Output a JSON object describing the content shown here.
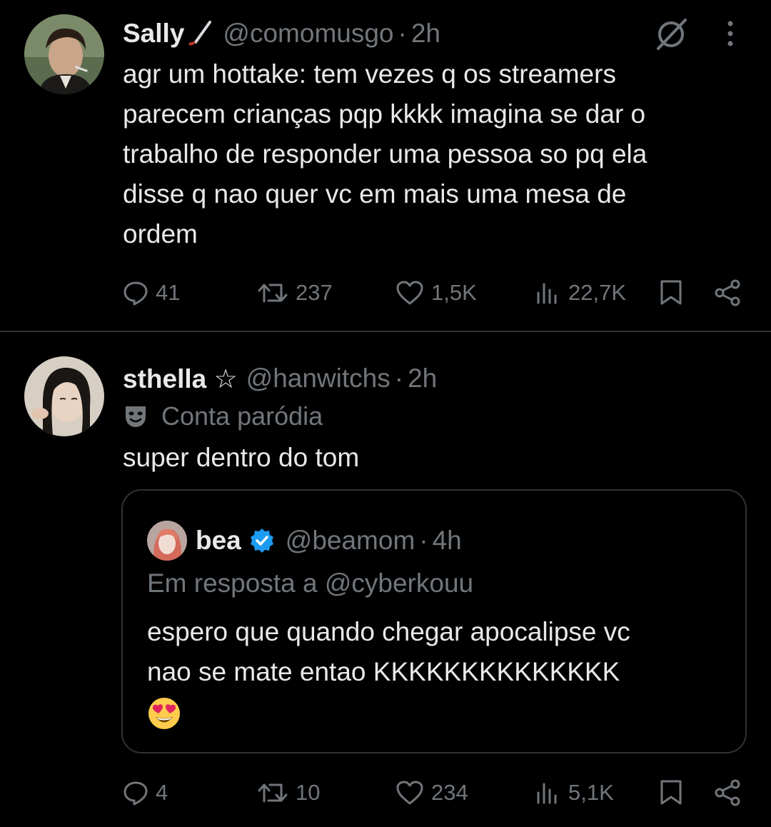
{
  "tweets": [
    {
      "name": "Sally",
      "name_emoji_icon": "hockey-stick-icon",
      "handle": "@comomusgo",
      "separator": "·",
      "time": "2h",
      "text": "agr um hottake: tem vezes q os streamers parecem crianças pqp kkkk imagina se dar o trabalho de responder uma pessoa so pq ela disse q nao quer vc em mais uma mesa de ordem",
      "text_lines": [
        "agr um hottake: tem vezes q os streamers",
        "parecem crianças pqp kkkk imagina se dar o",
        "trabalho de responder uma pessoa so pq ela",
        "disse q nao quer vc em mais uma mesa de",
        "ordem"
      ],
      "stats": {
        "replies": "41",
        "retweets": "237",
        "likes": "1,5K",
        "views": "22,7K"
      }
    },
    {
      "name": "sthella ☆",
      "handle": "@hanwitchs",
      "separator": "·",
      "time": "2h",
      "parody_label": "Conta paródia",
      "text": "super dentro do tom",
      "quote": {
        "name": "bea",
        "handle": "@beamom",
        "separator": "·",
        "time": "4h",
        "reply_to": "Em resposta a @cyberkouu",
        "text_lines": [
          "espero que quando chegar apocalipse vc",
          "nao se mate entao KKKKKKKKKKKKKK"
        ],
        "emoji": "😍"
      },
      "stats": {
        "replies": "4",
        "retweets": "10",
        "likes": "234",
        "views": "5,1K"
      }
    }
  ],
  "colors": {
    "background": "#000000",
    "text": "#e7e9ea",
    "secondary": "#71767b",
    "border": "#2f3336",
    "verified": "#1d9bf0"
  }
}
